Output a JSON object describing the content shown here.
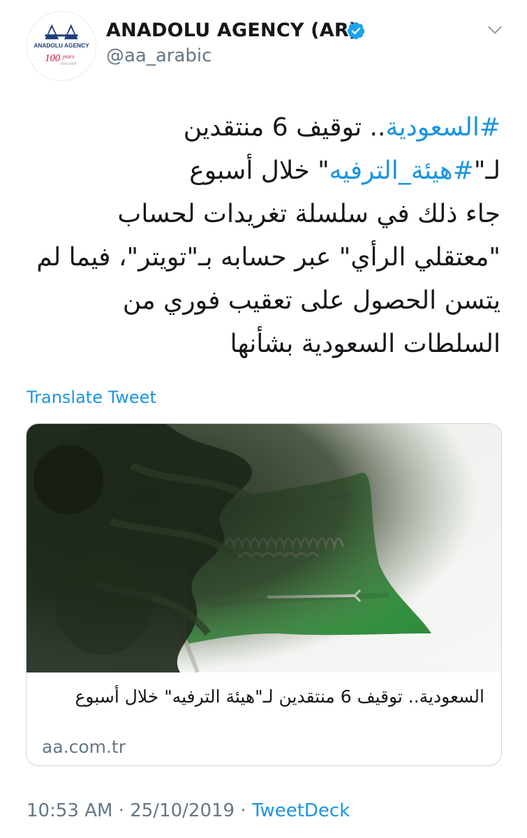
{
  "header": {
    "display_name": "ANADOLU AGENCY (AR)",
    "handle": "@aa_arabic",
    "avatar": {
      "logo_text": "AA",
      "agency_text": "ANADOLU AGENCY",
      "years_text": "100",
      "years_label": "years",
      "years_range": "1920-2020"
    }
  },
  "tweet": {
    "lines": [
      {
        "link": "#السعودية",
        "text": ".. توقيف 6 منتقدين"
      },
      {
        "prefix": "لـ\"",
        "link": "#هيئة_الترفيه",
        "text": "\" خلال أسبوع"
      },
      {
        "text": "جاء ذلك في سلسلة تغريدات لحساب"
      },
      {
        "text": "\"معتقلي الرأي\" عبر حسابه بـ\"تويتر\"، فيما لم"
      },
      {
        "text": "يتسن الحصول على تعقيب فوري من"
      },
      {
        "text": "السلطات السعودية بشأنها"
      }
    ]
  },
  "translate_label": "Translate Tweet",
  "card": {
    "title": "السعودية.. توقيف 6 منتقدين لـ\"هيئة الترفيه\" خلال أسبوع",
    "domain": "aa.com.tr",
    "image_subject": "saudi-flag-photo"
  },
  "meta": {
    "time": "10:53 AM",
    "separator": "·",
    "date": "25/10/2019",
    "source": "TweetDeck"
  },
  "colors": {
    "link": "#1b95e0",
    "secondary_text": "#657786",
    "verified": "#1da1f2",
    "brand_blue": "#1f3e7c",
    "flag_green": "#2f8a3c"
  },
  "icons": [
    "verified-badge-icon",
    "chevron-down-icon"
  ]
}
